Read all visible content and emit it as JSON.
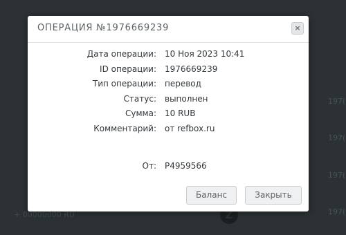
{
  "modal": {
    "title": "ОПЕРАЦИЯ №1976669239",
    "close_icon": "×",
    "rows": [
      {
        "label": "Дата операции:",
        "value": "10 Ноя 2023 10:41"
      },
      {
        "label": "ID операции:",
        "value": "1976669239"
      },
      {
        "label": "Тип операции:",
        "value": "перевод"
      },
      {
        "label": "Статус:",
        "value": "выполнен"
      },
      {
        "label": "Сумма:",
        "value": "10 RUB"
      },
      {
        "label": "Комментарий:",
        "value": "от refbox.ru"
      }
    ],
    "from": {
      "label": "От:",
      "value": "P4959566"
    },
    "buttons": {
      "balance": "Баланс",
      "close": "Закрыть"
    }
  },
  "background": {
    "right_snippets": [
      "197(",
      "197(",
      "197(",
      "197("
    ],
    "left_snippet": "+ 00000000 RU",
    "coin_icon": "Z"
  }
}
